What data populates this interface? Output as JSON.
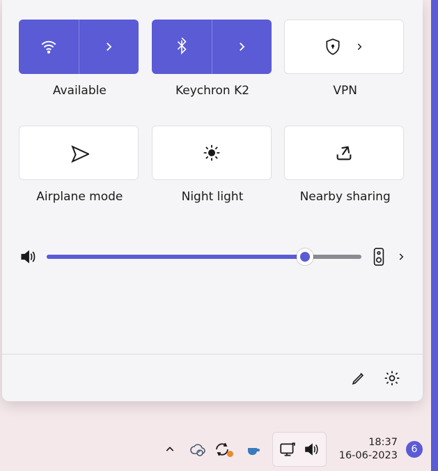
{
  "colors": {
    "accent": "#5b5bd6"
  },
  "tiles": {
    "wifi_label": "Available",
    "bluetooth_label": "Keychron K2",
    "vpn_label": "VPN",
    "airplane_label": "Airplane mode",
    "nightlight_label": "Night light",
    "nearby_label": "Nearby sharing"
  },
  "volume": {
    "percent": 82
  },
  "taskbar": {
    "time": "18:37",
    "date": "16-06-2023",
    "notification_count": "6"
  }
}
